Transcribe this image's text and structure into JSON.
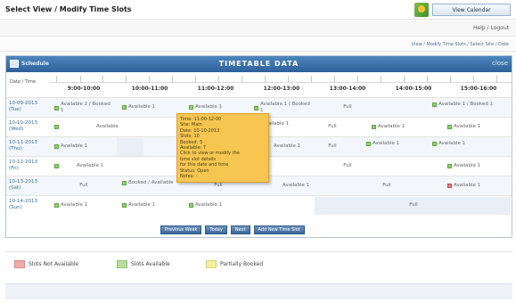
{
  "header": {
    "app_title": "Select View / Modify Time Slots",
    "user_button": "View Calendar",
    "sub_right": "Help / Logout",
    "crumb": "View / Modify Time Slots / Select Site / Date"
  },
  "panel": {
    "left_label": "Schedule",
    "title": "TIMETABLE DATA",
    "close": "close",
    "header_label": "Date / Time"
  },
  "time_slots": [
    "9:00-10:00",
    "10:00-11:00",
    "11:00-12:00",
    "12:00-13:00",
    "13:00-14:00",
    "14:00-15:00",
    "15:00-16:00"
  ],
  "rows": [
    {
      "day": "10-09-2013 (Tue)",
      "cells": [
        "Available 2 / Booked 1",
        "Available 1",
        "Available 1",
        "Available 1 / Booked 1",
        "Full",
        "Available 1 / Booked 1",
        ""
      ]
    },
    {
      "day": "10-10-2013 (Wed)",
      "cells": [
        "Available",
        "",
        "Available 1",
        "Full",
        "Available 1",
        "Available 1",
        ""
      ]
    },
    {
      "day": "10-11-2013 (Thu)",
      "cells": [
        "Available 1",
        "",
        "",
        "Available 1",
        "Full",
        "Available 1",
        "Available 1"
      ]
    },
    {
      "day": "10-12-2013 (Fri)",
      "cells": [
        "Available 1",
        "",
        "",
        "Full",
        "",
        "Available 1",
        ""
      ]
    },
    {
      "day": "10-13-2013 (Sat)",
      "cells": [
        "Full",
        "Booked / Available",
        "Full",
        "Available 1",
        "Full",
        "Available 1",
        ""
      ]
    },
    {
      "day": "10-14-2013 (Sun)",
      "cells": [
        "Available 1",
        "Available 1",
        "Available 1",
        "",
        "Full",
        "",
        ""
      ]
    }
  ],
  "tooltip_lines": [
    "Time: 11:00-12:00",
    "Site: Main",
    "Date: 10-10-2013",
    "Slots: 10",
    "Booked: 3",
    "Available: 7",
    "Click to view or modify the",
    "time slot details",
    "for this date and time",
    "Status: Open",
    "Notes: -"
  ],
  "buttons": [
    "Previous Week",
    "Today",
    "Next",
    "Add New Time Slot"
  ],
  "legend": [
    {
      "label": "Slots Not Available",
      "color": "#f4a7a7"
    },
    {
      "label": "Slots Available",
      "color": "#b7dea0"
    },
    {
      "label": "Partially Booked",
      "color": "#f3ef9c"
    }
  ],
  "colors": {
    "header_blue": "#3a6ea5",
    "tooltip": "#f6c650",
    "available_green": "#8fcf6d",
    "full_red": "#ef7d7d"
  }
}
